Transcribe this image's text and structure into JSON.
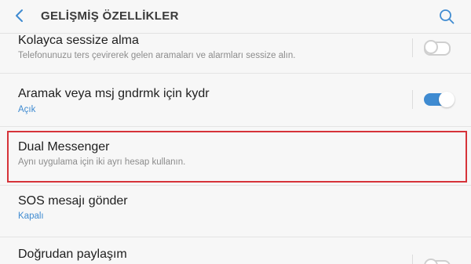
{
  "header": {
    "title": "GELİŞMİŞ ÖZELLİKLER",
    "back_icon": "chevron-left-icon",
    "search_icon": "search-icon",
    "accent_color": "#3f8bd1"
  },
  "settings": {
    "items": [
      {
        "title": "Kolayca sessize alma",
        "subtitle": "Telefonunuzu ters çevirerek gelen aramaları ve alarmları sessize alın.",
        "toggle": "off"
      },
      {
        "title": "Aramak veya msj gndrmk için kydr",
        "subtitle": "Açık",
        "toggle": "on"
      },
      {
        "title": "Dual Messenger",
        "subtitle": "Aynı uygulama için iki ayrı hesap kullanın.",
        "highlighted": true
      },
      {
        "title": "SOS mesajı gönder",
        "subtitle": "Kapalı"
      },
      {
        "title": "Doğrudan paylaşım",
        "toggle": "off"
      }
    ]
  },
  "highlight_color": "#d63339"
}
